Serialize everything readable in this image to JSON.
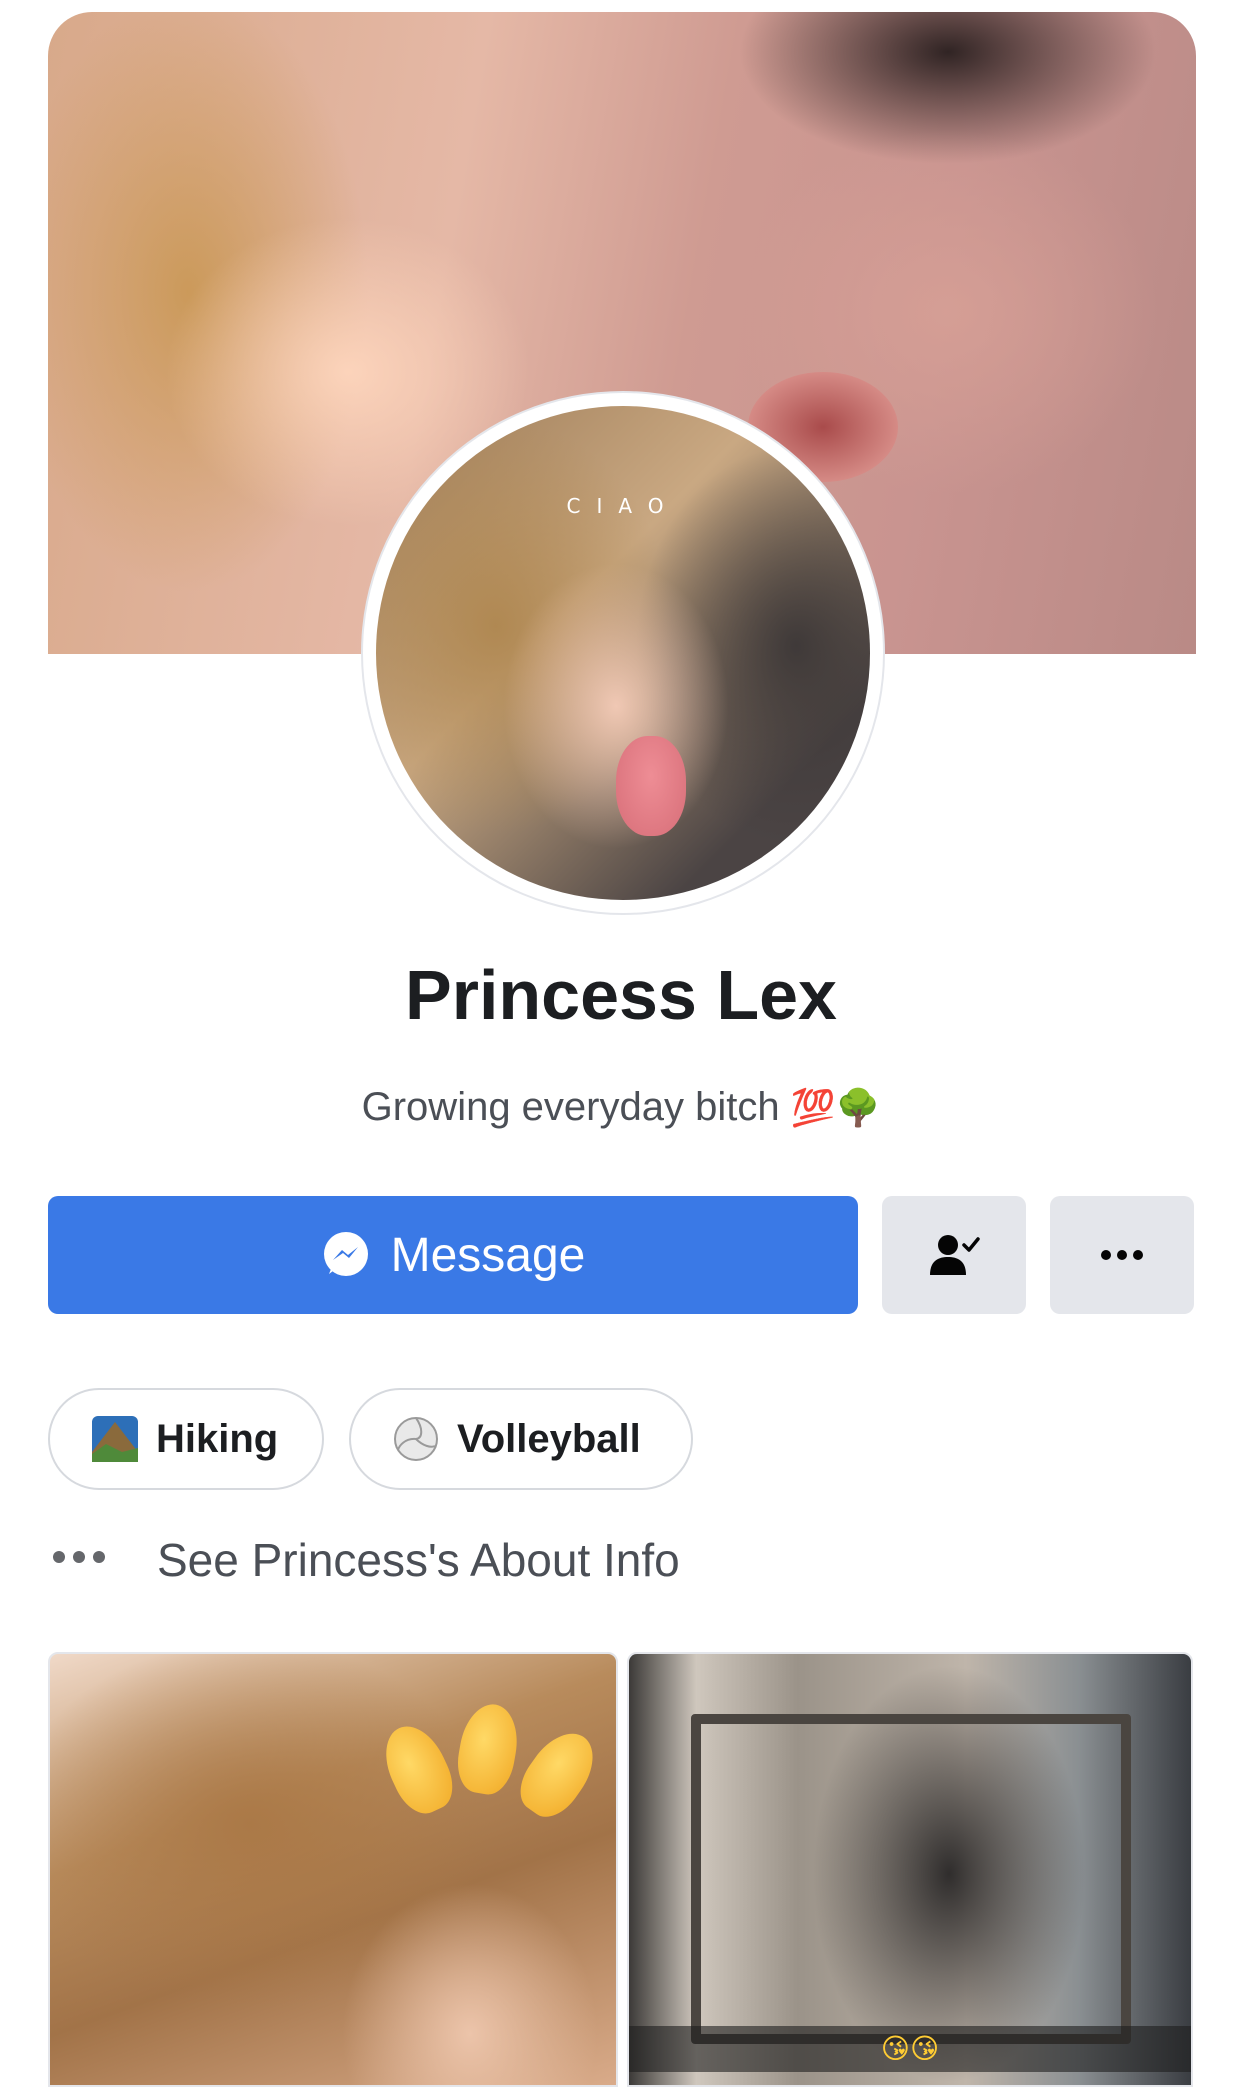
{
  "profile": {
    "name": "Princess Lex",
    "bio_text": "Growing everyday bitch",
    "bio_emoji_100": "💯",
    "bio_emoji_tree": "🌳",
    "avatar_caption": "CIAO"
  },
  "actions": {
    "message_label": "Message"
  },
  "hobbies": [
    {
      "label": "Hiking",
      "icon": "mountain-icon"
    },
    {
      "label": "Volleyball",
      "icon": "volleyball-icon"
    }
  ],
  "about": {
    "link_label": "See Princess's About Info"
  },
  "photos": {
    "photo2_caption": "😘😘"
  },
  "colors": {
    "primary_blue": "#3a79e6",
    "gray_button": "#e4e6eb",
    "text_dark": "#1c1e21",
    "text_secondary": "#4b4f56"
  }
}
